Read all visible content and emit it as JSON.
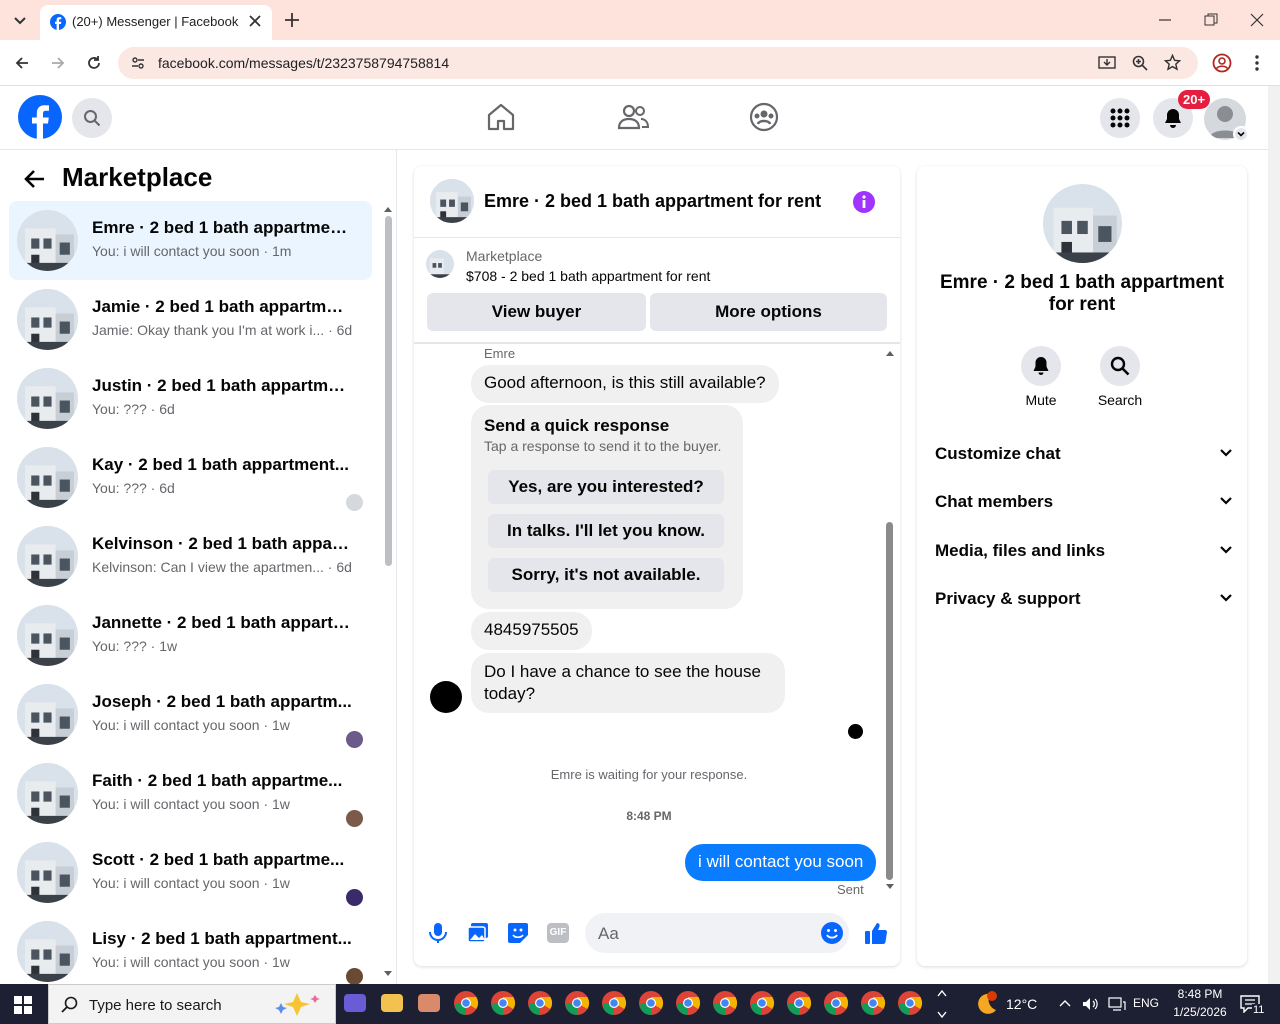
{
  "browser": {
    "tab_title": "(20+) Messenger | Facebook",
    "url": "facebook.com/messages/t/2323758794758814"
  },
  "fb_header": {
    "notification_badge": "20+"
  },
  "left_panel": {
    "title": "Marketplace",
    "conversations": [
      {
        "name": "Emre · 2 bed 1 bath appartment ...",
        "sub": "You: i will contact you soon · 1m",
        "active": true
      },
      {
        "name": "Jamie · 2 bed 1 bath appartment...",
        "sub": "Jamie: Okay thank you I'm at work i... · 6d"
      },
      {
        "name": "Justin · 2 bed 1 bath appartment...",
        "sub": "You: ??? · 6d"
      },
      {
        "name": "Kay · 2 bed 1 bath appartment...",
        "sub": "You: ??? · 6d"
      },
      {
        "name": "Kelvinson · 2 bed 1 bath appart...",
        "sub": "Kelvinson: Can I view the apartmen... · 6d"
      },
      {
        "name": "Jannette · 2 bed 1 bath appartm...",
        "sub": "You: ??? · 1w"
      },
      {
        "name": "Joseph · 2 bed 1 bath appartm...",
        "sub": "You: i will contact you soon · 1w"
      },
      {
        "name": "Faith · 2 bed 1 bath appartme...",
        "sub": "You: i will contact you soon · 1w"
      },
      {
        "name": "Scott · 2 bed 1 bath appartme...",
        "sub": "You: i will contact you soon · 1w"
      },
      {
        "name": "Lisy · 2 bed 1 bath appartment...",
        "sub": "You: i will contact you soon · 1w"
      }
    ]
  },
  "chat": {
    "title": "Emre · 2 bed 1 bath appartment for rent",
    "listing_source": "Marketplace",
    "listing_title": "$708 - 2 bed 1 bath appartment for rent",
    "view_buyer": "View buyer",
    "more_options": "More options",
    "sender_name": "Emre",
    "msg1": "Good afternoon, is this still available?",
    "quick_title": "Send a quick response",
    "quick_sub": "Tap a response to send it to the buyer.",
    "quick_options": [
      "Yes, are you interested?",
      "In talks. I'll let you know.",
      "Sorry, it's not available."
    ],
    "msg2": "4845975505",
    "msg3": "Do I have a chance to see the house today?",
    "waiting": "Emre is waiting for your response.",
    "time": "8:48 PM",
    "sent_msg": "i will contact you soon",
    "sent_status": "Sent",
    "composer_placeholder": "Aa"
  },
  "info_panel": {
    "name": "Emre · 2 bed 1 bath appartment for rent",
    "mute": "Mute",
    "search": "Search",
    "sections": [
      "Customize chat",
      "Chat members",
      "Media, files and links",
      "Privacy & support"
    ]
  },
  "taskbar": {
    "search_placeholder": "Type here to search",
    "temperature": "12°C",
    "language": "ENG",
    "time": "8:48 PM",
    "date": "1/25/2026",
    "notif_count": "11"
  },
  "colors": {
    "fb_blue": "#0866ff",
    "sent_bubble": "#0a7cff",
    "info_purple": "#a033ff"
  }
}
